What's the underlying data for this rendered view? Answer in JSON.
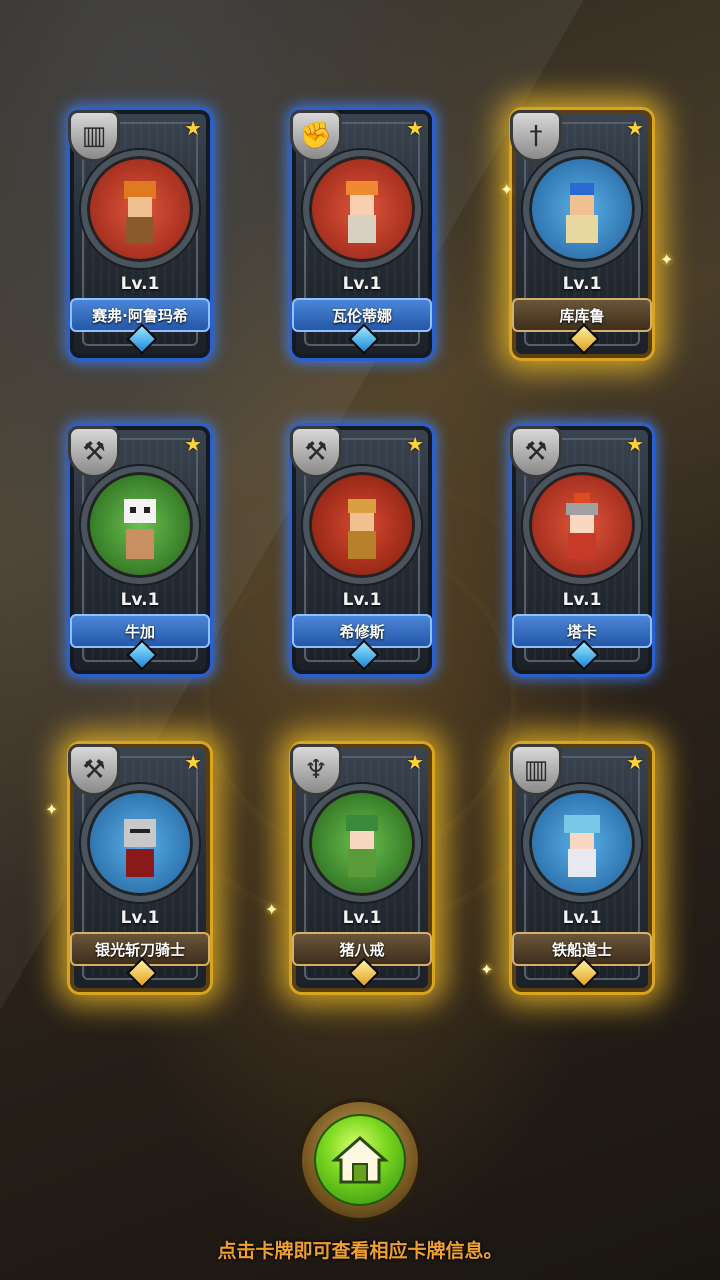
{
  "cards": [
    {
      "name": "赛弗·阿鲁玛希",
      "level": "Lv.1",
      "rarity": "blue",
      "class_icon": "book-icon",
      "portrait_color": "#c0392b"
    },
    {
      "name": "瓦伦蒂娜",
      "level": "Lv.1",
      "rarity": "blue",
      "class_icon": "fist-icon",
      "portrait_color": "#c0392b"
    },
    {
      "name": "库库鲁",
      "level": "Lv.1",
      "rarity": "gold",
      "class_icon": "sword-icon",
      "portrait_color": "#2e7fc0"
    },
    {
      "name": "牛加",
      "level": "Lv.1",
      "rarity": "blue",
      "class_icon": "axe-icon",
      "portrait_color": "#3a8a2a"
    },
    {
      "name": "希修斯",
      "level": "Lv.1",
      "rarity": "blue",
      "class_icon": "axe-icon",
      "portrait_color": "#b83a2a"
    },
    {
      "name": "塔卡",
      "level": "Lv.1",
      "rarity": "blue",
      "class_icon": "axe-icon",
      "portrait_color": "#c0392b"
    },
    {
      "name": "银光斩刀骑士",
      "level": "Lv.1",
      "rarity": "gold",
      "class_icon": "axe-icon",
      "portrait_color": "#2e7fc0"
    },
    {
      "name": "猪八戒",
      "level": "Lv.1",
      "rarity": "gold",
      "class_icon": "wings-icon",
      "portrait_color": "#3a8a2a"
    },
    {
      "name": "铁船道士",
      "level": "Lv.1",
      "rarity": "gold",
      "class_icon": "book-icon",
      "portrait_color": "#2e7fc0"
    }
  ],
  "hint_text": "点击卡牌即可查看相应卡牌信息。",
  "home_button_icon": "home-icon"
}
